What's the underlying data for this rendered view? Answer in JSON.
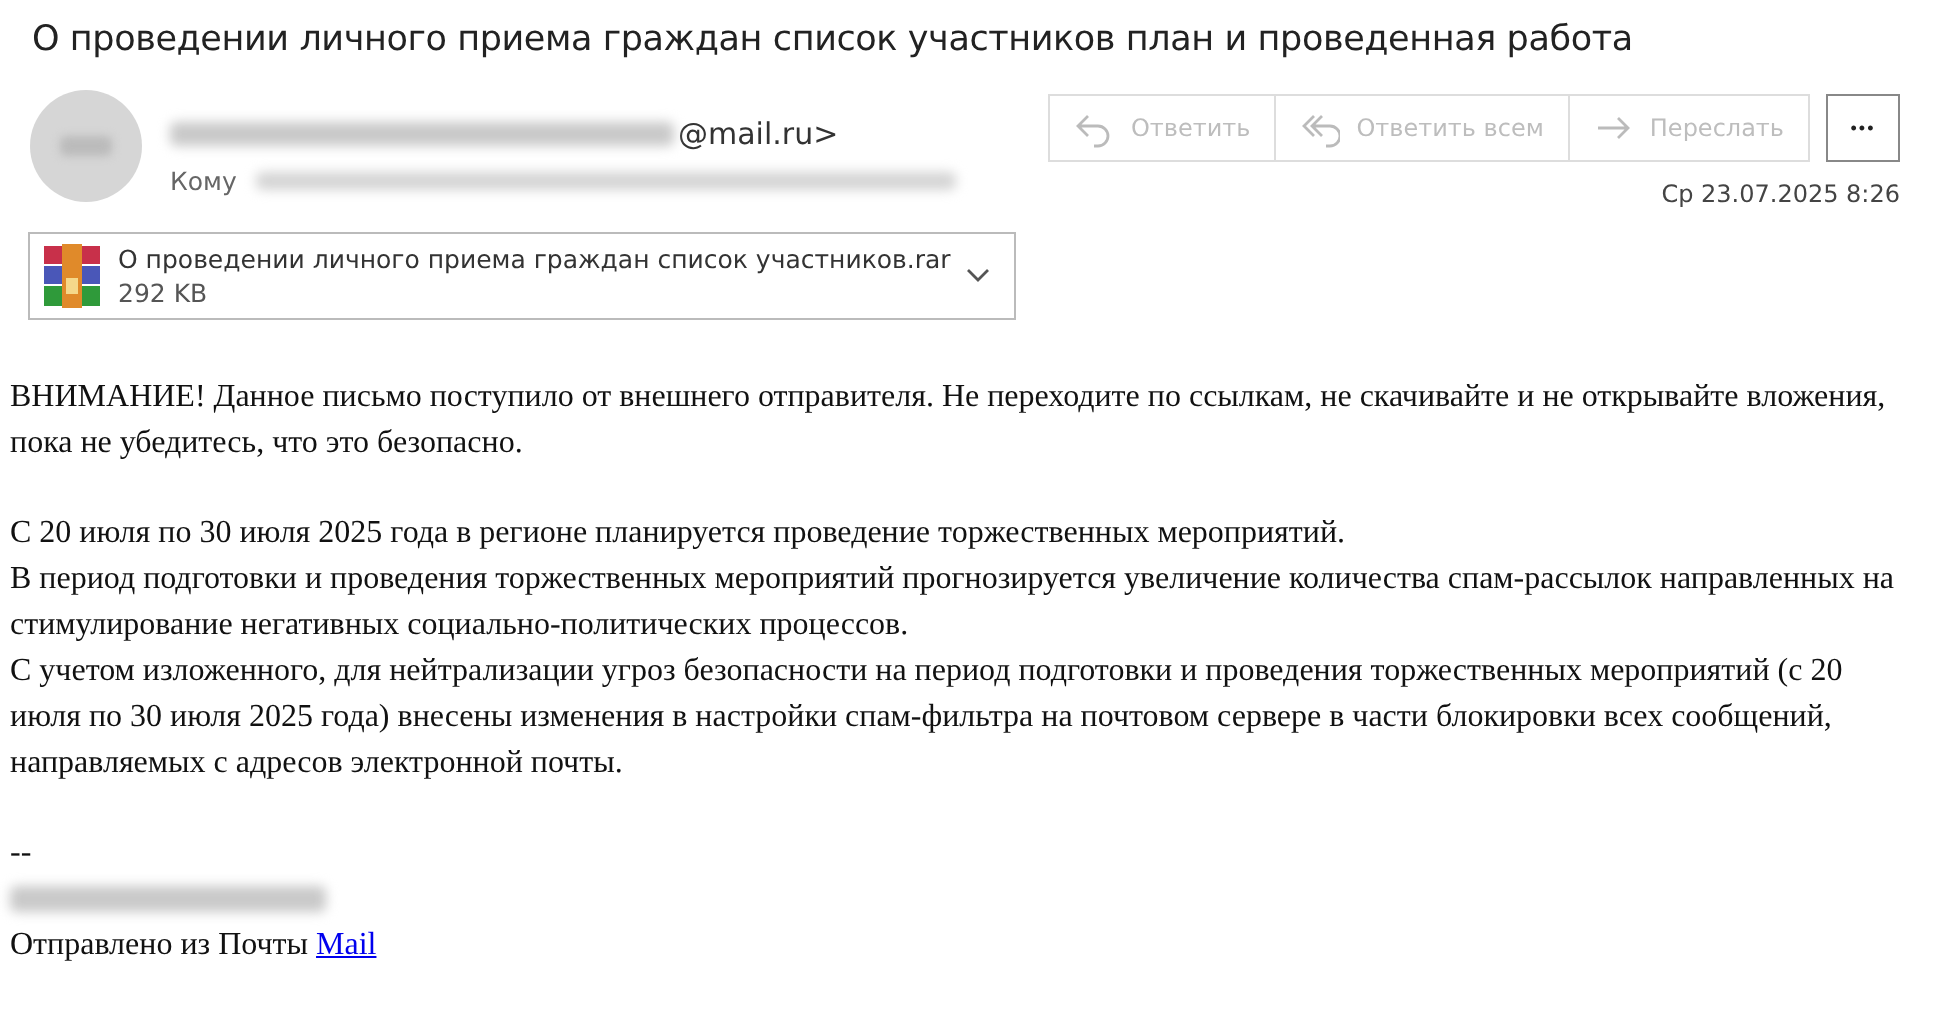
{
  "subject": "О проведении личного приема граждан список участников план и проведенная работа",
  "sender": {
    "address_visible": "@mail.ru>",
    "to_label": "Кому"
  },
  "actions": [
    {
      "kind": "reply",
      "label": "Ответить",
      "disabled": true
    },
    {
      "kind": "reply_all",
      "label": "Ответить всем",
      "disabled": true
    },
    {
      "kind": "forward",
      "label": "Переслать",
      "disabled": true
    }
  ],
  "more_button": {
    "label": "•••"
  },
  "date": "Ср 23.07.2025 8:26",
  "attachment": {
    "name": "О проведении личного приема граждан список участников.rar",
    "size": "292 KB"
  },
  "body": [
    {
      "kind": "paragraph",
      "lines": [
        "ВНИМАНИЕ! Данное письмо поступило от внешнего отправителя. Не переходите по ссылкам, не скачивайте и не открывайте вложения, пока не убедитесь, что это безопасно."
      ]
    },
    {
      "kind": "paragraph",
      "lines": [
        "С 20 июля по 30 июля 2025 года в регионе планируется проведение торжественных мероприятий.",
        "В период подготовки и проведения торжественных мероприятий прогнозируется увеличение количества спам-рассылок направленных на стимулирование негативных социально-политических процессов.",
        "С учетом изложенного, для нейтрализации угроз безопасности на период подготовки и проведения торжественных мероприятий (с 20 июля по 30 июля 2025 года) внесены изменения в настройки спам-фильтра на почтовом сервере в части блокировки всех сообщений, направляемых с адресов электронной почты."
      ]
    }
  ],
  "signature": {
    "dashes": "--",
    "sent_from": "Отправлено из Почты",
    "link": "Mail"
  }
}
